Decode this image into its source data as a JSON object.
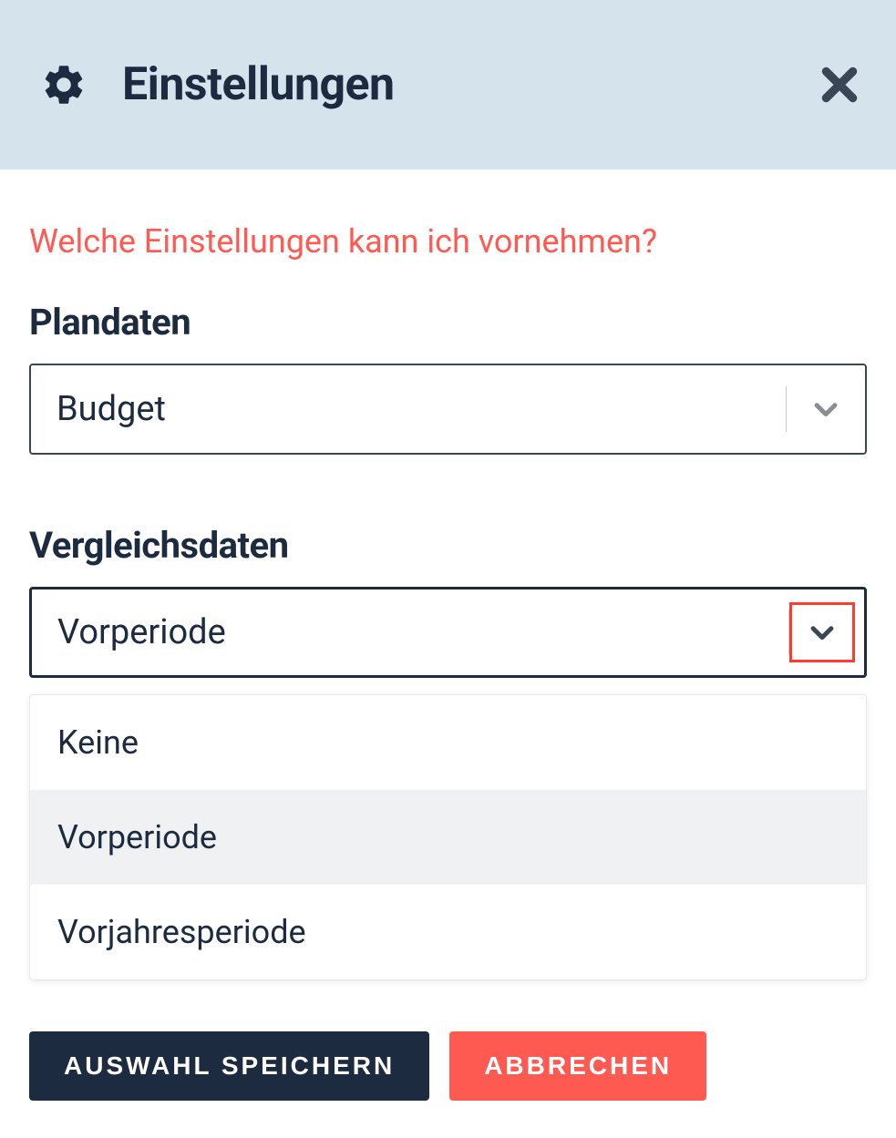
{
  "header": {
    "title": "Einstellungen"
  },
  "help_link": "Welche Einstellungen kann ich vornehmen?",
  "plandaten": {
    "label": "Plandaten",
    "selected": "Budget"
  },
  "vergleichsdaten": {
    "label": "Vergleichsdaten",
    "selected": "Vorperiode",
    "options": [
      "Keine",
      "Vorperiode",
      "Vorjahresperiode"
    ],
    "selected_index": 1
  },
  "buttons": {
    "save": "AUSWAHL SPEICHERN",
    "cancel": "ABBRECHEN"
  }
}
